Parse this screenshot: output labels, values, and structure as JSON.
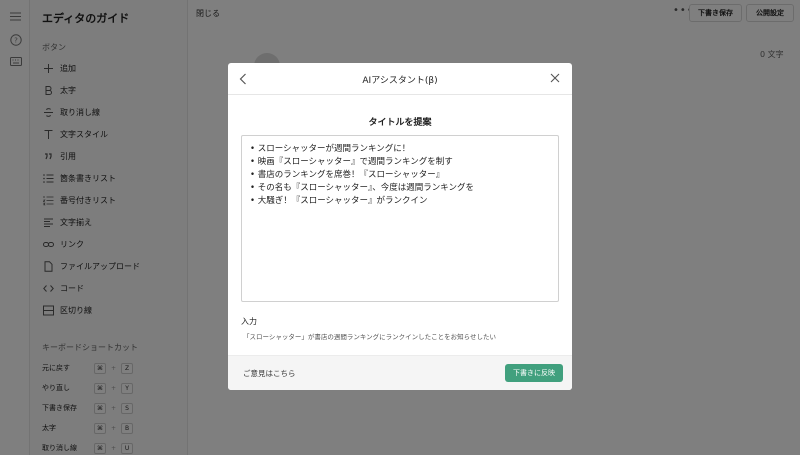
{
  "guide": {
    "title": "エディタのガイド",
    "buttons_section": "ボタン",
    "items": [
      {
        "label": "追加",
        "icon": "plus-icon"
      },
      {
        "label": "太字",
        "icon": "bold-icon"
      },
      {
        "label": "取り消し線",
        "icon": "strikethrough-icon"
      },
      {
        "label": "文字スタイル",
        "icon": "text-style-icon"
      },
      {
        "label": "引用",
        "icon": "quote-icon"
      },
      {
        "label": "箇条書きリスト",
        "icon": "bullet-list-icon"
      },
      {
        "label": "番号付きリスト",
        "icon": "numbered-list-icon"
      },
      {
        "label": "文字揃え",
        "icon": "align-icon"
      },
      {
        "label": "リンク",
        "icon": "link-icon"
      },
      {
        "label": "ファイルアップロード",
        "icon": "file-icon"
      },
      {
        "label": "コード",
        "icon": "code-icon"
      },
      {
        "label": "区切り線",
        "icon": "divider-icon"
      }
    ],
    "shortcuts_section": "キーボードショートカット",
    "shortcuts": [
      {
        "label": "元に戻す",
        "keys": [
          "⌘",
          "Z"
        ]
      },
      {
        "label": "やり直し",
        "keys": [
          "⌘",
          "Y"
        ]
      },
      {
        "label": "下書き保存",
        "keys": [
          "⌘",
          "S"
        ]
      },
      {
        "label": "太字",
        "keys": [
          "⌘",
          "B"
        ]
      },
      {
        "label": "取り消し線",
        "keys": [
          "⌘",
          "U"
        ]
      }
    ],
    "plus_sign": "+"
  },
  "topbar": {
    "close": "閉じる",
    "more": "•••",
    "save_draft": "下書き保存",
    "publish_settings": "公開設定"
  },
  "editor": {
    "char_count": "0 文字"
  },
  "modal": {
    "title": "AIアシスタント(β)",
    "subtitle": "タイトルを提案",
    "suggestions": [
      "• スローシャッターが週間ランキングに！",
      "• 映画『スローシャッター』で週間ランキングを制す",
      "• 書店のランキングを席巻！『スローシャッター』",
      "• その名も『スローシャッター』、今度は週間ランキングを",
      "• 大騒ぎ！『スローシャッター』がランクイン"
    ],
    "input_label": "入力",
    "input_text": "「スローシャッター」が書店の週間ランキングにランクインしたことをお知らせしたい",
    "feedback_link": "ご意見はこちら",
    "apply_button": "下書きに反映"
  },
  "colors": {
    "overlay": "rgba(0,0,0,0.5)",
    "accent_green": "#41a07e"
  }
}
